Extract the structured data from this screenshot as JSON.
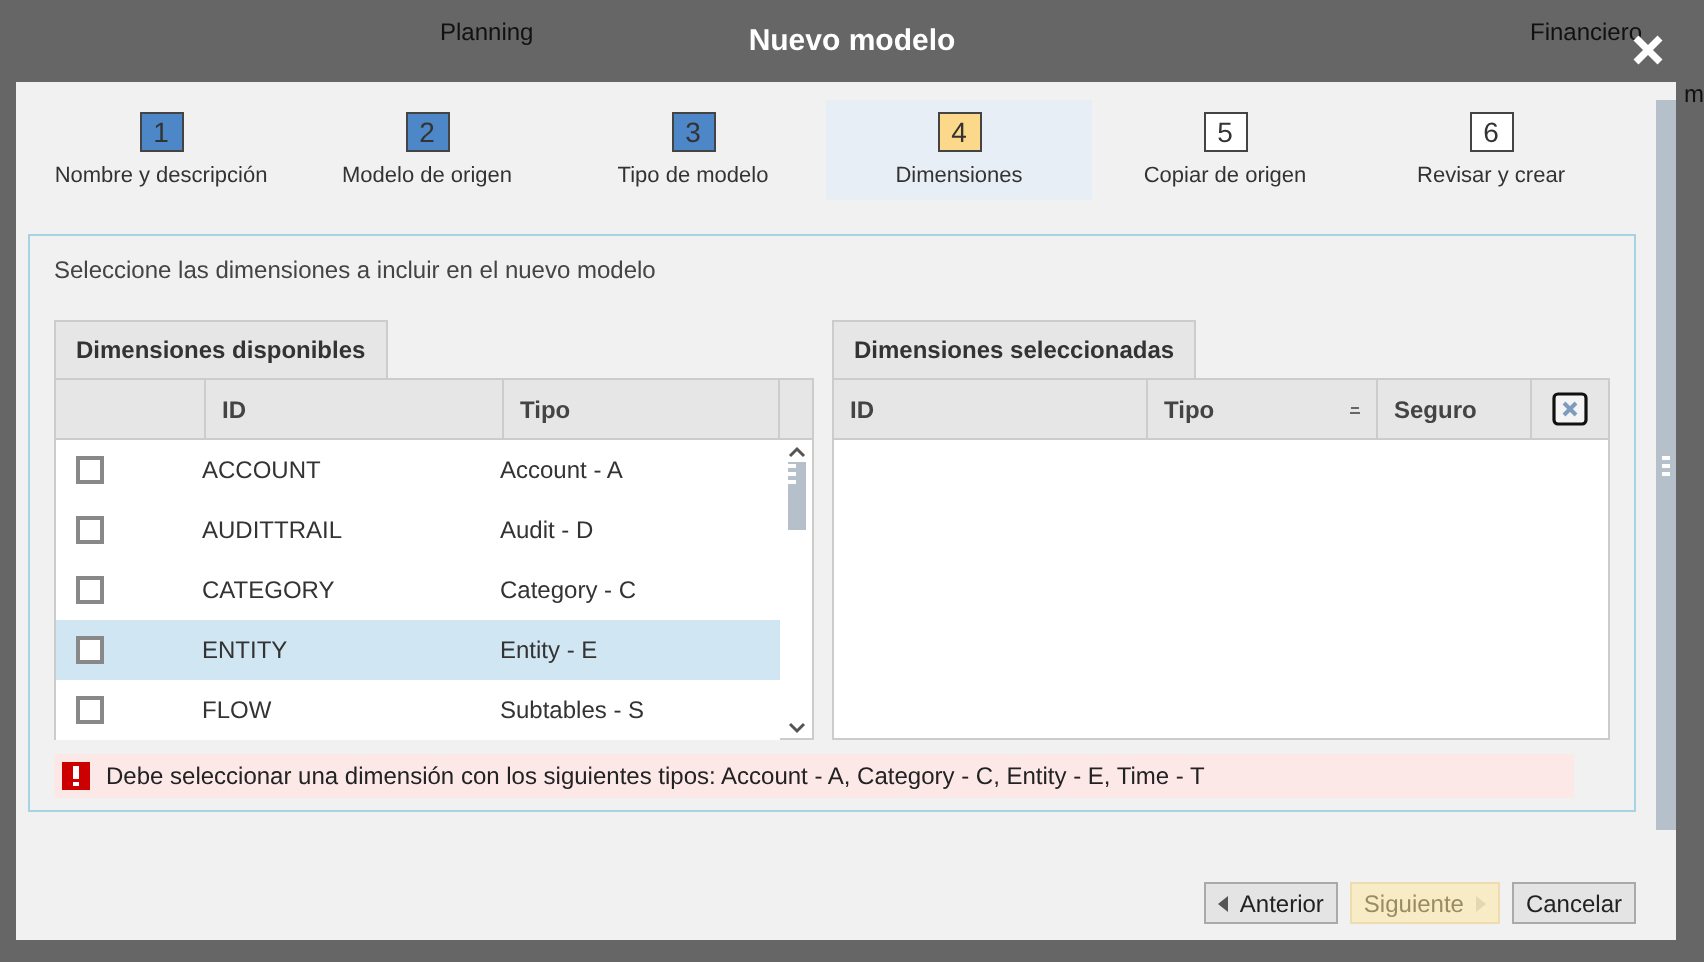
{
  "background_texts": [
    "Planning",
    "Financiero",
    "m"
  ],
  "window": {
    "title": "Nuevo modelo"
  },
  "steps": [
    {
      "number": "1",
      "label": "Nombre y descripción",
      "done": true,
      "selected": false
    },
    {
      "number": "2",
      "label": "Modelo de origen",
      "done": true,
      "selected": false
    },
    {
      "number": "3",
      "label": "Tipo de modelo",
      "done": true,
      "selected": false
    },
    {
      "number": "4",
      "label": "Dimensiones",
      "done": false,
      "selected": true
    },
    {
      "number": "5",
      "label": "Copiar de origen",
      "done": false,
      "selected": false
    },
    {
      "number": "6",
      "label": "Revisar y crear",
      "done": false,
      "selected": false
    }
  ],
  "instruction": "Seleccione las dimensiones a incluir en el nuevo modelo",
  "available": {
    "tab": "Dimensiones disponibles",
    "columns": [
      "ID",
      "Tipo"
    ],
    "rows": [
      {
        "id": "ACCOUNT",
        "type": "Account - A",
        "checked": false,
        "selected": false
      },
      {
        "id": "AUDITTRAIL",
        "type": "Audit - D",
        "checked": false,
        "selected": false
      },
      {
        "id": "CATEGORY",
        "type": "Category - C",
        "checked": false,
        "selected": false
      },
      {
        "id": "ENTITY",
        "type": "Entity - E",
        "checked": false,
        "selected": true
      },
      {
        "id": "FLOW",
        "type": "Subtables - S",
        "checked": false,
        "selected": false
      }
    ]
  },
  "selected_dims": {
    "tab": "Dimensiones seleccionadas",
    "columns": [
      {
        "label": "ID",
        "sorted": false
      },
      {
        "label": "Tipo",
        "sorted": true
      },
      {
        "label": "Seguro",
        "sorted": false
      }
    ]
  },
  "error": "Debe seleccionar una dimensión con los siguientes tipos: Account - A, Category - C, Entity - E, Time - T",
  "buttons": [
    {
      "label": "Anterior",
      "kind": "prev",
      "disabled": false
    },
    {
      "label": "Siguiente",
      "kind": "next",
      "disabled": true
    },
    {
      "label": "Cancelar",
      "kind": "plain",
      "disabled": false
    }
  ]
}
